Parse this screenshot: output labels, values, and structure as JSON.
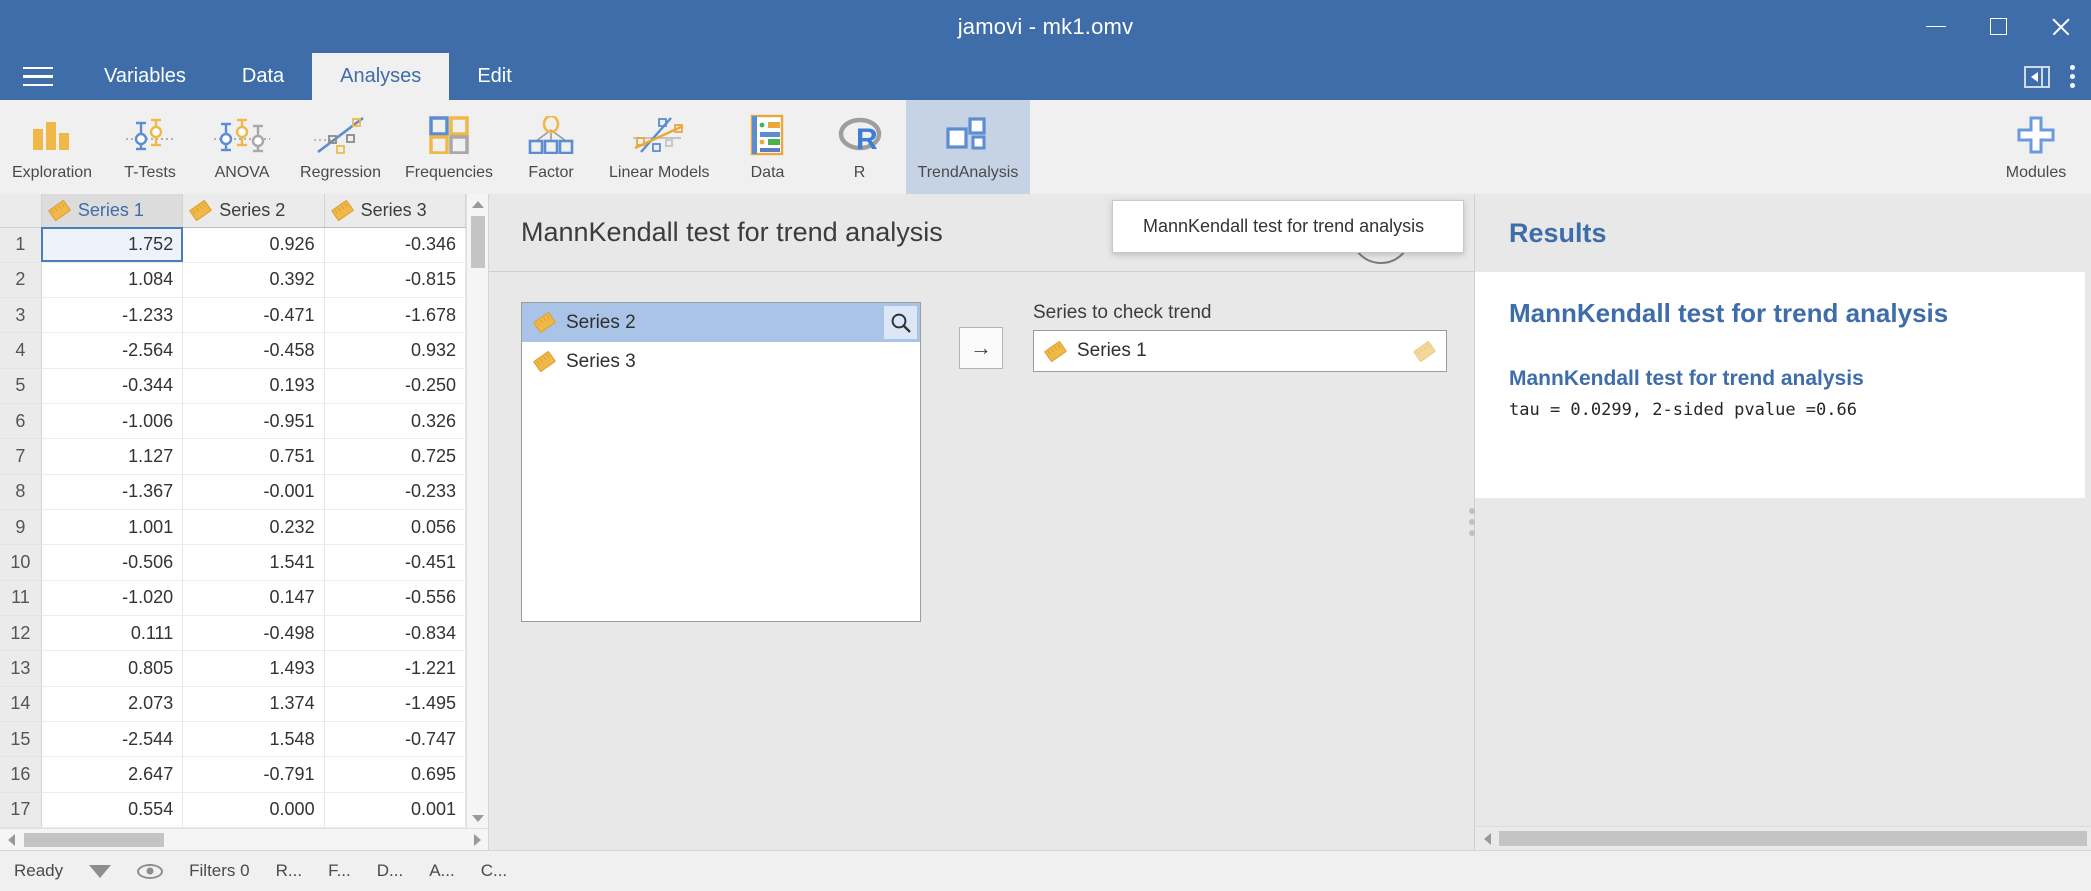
{
  "window": {
    "title": "jamovi - mk1.omv",
    "minimize": "minimize-button",
    "maximize": "maximize-button",
    "close": "close-button"
  },
  "tabs": [
    {
      "label": "Variables",
      "active": false
    },
    {
      "label": "Data",
      "active": false
    },
    {
      "label": "Analyses",
      "active": true
    },
    {
      "label": "Edit",
      "active": false
    }
  ],
  "ribbon": {
    "items": [
      {
        "label": "Exploration",
        "icon": "bar-chart-icon",
        "active": false
      },
      {
        "label": "T-Tests",
        "icon": "t-tests-icon",
        "active": false
      },
      {
        "label": "ANOVA",
        "icon": "anova-icon",
        "active": false
      },
      {
        "label": "Regression",
        "icon": "regression-icon",
        "active": false
      },
      {
        "label": "Frequencies",
        "icon": "frequencies-icon",
        "active": false
      },
      {
        "label": "Factor",
        "icon": "factor-icon",
        "active": false
      },
      {
        "label": "Linear Models",
        "icon": "linear-models-icon",
        "active": false
      },
      {
        "label": "Data",
        "icon": "data-icon",
        "active": false
      },
      {
        "label": "R",
        "icon": "r-icon",
        "active": false
      },
      {
        "label": "TrendAnalysis",
        "icon": "trend-analysis-icon",
        "active": true
      }
    ],
    "modules": {
      "label": "Modules",
      "icon": "plus-icon"
    }
  },
  "dropdown": {
    "visible": true,
    "items": [
      "MannKendall test for trend analysis"
    ]
  },
  "spreadsheet": {
    "columns": [
      {
        "name": "Series 1",
        "selected": true
      },
      {
        "name": "Series 2",
        "selected": false
      },
      {
        "name": "Series 3",
        "selected": false
      }
    ],
    "active_cell": {
      "row": 1,
      "column": 0
    },
    "rows": [
      {
        "n": "1",
        "values": [
          "1.752",
          "0.926",
          "-0.346"
        ]
      },
      {
        "n": "2",
        "values": [
          "1.084",
          "0.392",
          "-0.815"
        ]
      },
      {
        "n": "3",
        "values": [
          "-1.233",
          "-0.471",
          "-1.678"
        ]
      },
      {
        "n": "4",
        "values": [
          "-2.564",
          "-0.458",
          "0.932"
        ]
      },
      {
        "n": "5",
        "values": [
          "-0.344",
          "0.193",
          "-0.250"
        ]
      },
      {
        "n": "6",
        "values": [
          "-1.006",
          "-0.951",
          "0.326"
        ]
      },
      {
        "n": "7",
        "values": [
          "1.127",
          "0.751",
          "0.725"
        ]
      },
      {
        "n": "8",
        "values": [
          "-1.367",
          "-0.001",
          "-0.233"
        ]
      },
      {
        "n": "9",
        "values": [
          "1.001",
          "0.232",
          "0.056"
        ]
      },
      {
        "n": "10",
        "values": [
          "-0.506",
          "1.541",
          "-0.451"
        ]
      },
      {
        "n": "11",
        "values": [
          "-1.020",
          "0.147",
          "-0.556"
        ]
      },
      {
        "n": "12",
        "values": [
          "0.111",
          "-0.498",
          "-0.834"
        ]
      },
      {
        "n": "13",
        "values": [
          "0.805",
          "1.493",
          "-1.221"
        ]
      },
      {
        "n": "14",
        "values": [
          "2.073",
          "1.374",
          "-1.495"
        ]
      },
      {
        "n": "15",
        "values": [
          "-2.544",
          "1.548",
          "-0.747"
        ]
      },
      {
        "n": "16",
        "values": [
          "2.647",
          "-0.791",
          "0.695"
        ]
      },
      {
        "n": "17",
        "values": [
          "0.554",
          "0.000",
          "0.001"
        ]
      }
    ]
  },
  "options": {
    "title": "MannKendall test for trend analysis",
    "hide_button": "→",
    "variable_list": [
      {
        "label": "Series 2",
        "icon": "ruler-icon",
        "selected": true
      },
      {
        "label": "Series 3",
        "icon": "ruler-icon",
        "selected": false
      }
    ],
    "search_icon": "search-icon",
    "transfer_button": "→",
    "target": {
      "label": "Series to check trend",
      "value": "Series 1",
      "icon": "ruler-icon"
    }
  },
  "results": {
    "header": "Results",
    "heading": "MannKendall test for trend analysis",
    "subheading": "MannKendall test for trend analysis",
    "output": "tau = 0.0299, 2-sided pvalue =0.66"
  },
  "statusbar": {
    "state": "Ready",
    "filter_icon": "funnel-icon",
    "eye_icon": "eye-icon",
    "filters": "Filters 0",
    "truncated": [
      "R...",
      "F...",
      "D...",
      "A...",
      "C..."
    ]
  },
  "colors": {
    "titlebar": "#3e6da9",
    "accent": "#3e6da9",
    "ribbon_active": "#c5d3e4",
    "measure_icon": "#f0b849",
    "selection": "#aac4e8"
  }
}
